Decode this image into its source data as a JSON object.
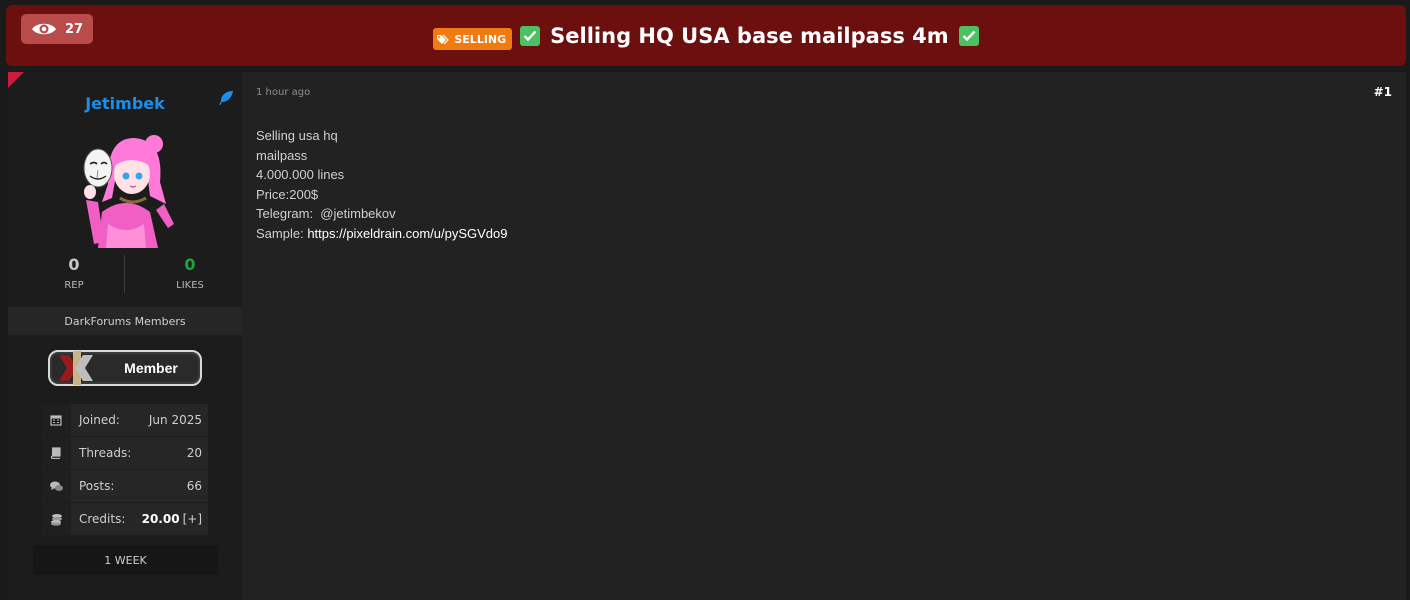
{
  "header": {
    "views": "27",
    "prefix": "SELLING",
    "title": "Selling HQ USA base mailpass 4m"
  },
  "user": {
    "name": "Jetimbek",
    "rep_value": "0",
    "rep_label": "REP",
    "likes_value": "0",
    "likes_label": "LIKES",
    "group": "DarkForums Members",
    "badge": "Member",
    "info": {
      "joined_label": "Joined:",
      "joined_value": "Jun 2025",
      "threads_label": "Threads:",
      "threads_value": "20",
      "posts_label": "Posts:",
      "posts_value": "66",
      "credits_label": "Credits:",
      "credits_value": "20.00",
      "credits_plus": "[+]"
    },
    "last_seen": "1 WEEK"
  },
  "post": {
    "time": "1 hour ago",
    "number": "#1",
    "lines": [
      "Selling usa hq",
      "mailpass",
      "4.000.000 lines",
      "Price:200$",
      "Telegram:  @jetimbekov"
    ],
    "sample_label": "Sample: ",
    "sample_link": "https://pixeldrain.com/u/pySGVdo9"
  },
  "colors": {
    "header_bg": "#6b0f0f",
    "username": "#1d8de9",
    "likes": "#1fa33a",
    "prefix": "#f07b10"
  },
  "icons": {
    "views": "eye-icon",
    "prefix": "tag-icon",
    "check": "check-mark-icon",
    "joined": "calendar-icon",
    "threads": "book-icon",
    "posts": "comments-icon",
    "credits": "coins-icon",
    "online": "feather-icon"
  }
}
